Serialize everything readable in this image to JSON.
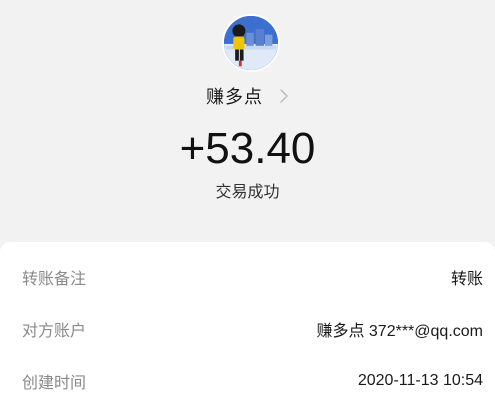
{
  "header": {
    "avatar_icon": "cartoon-avatar-icon",
    "payee_name": "赚多点",
    "chevron_icon": "chevron-right-icon",
    "amount": "+53.40",
    "status": "交易成功"
  },
  "details": [
    {
      "label": "转账备注",
      "value": "转账"
    },
    {
      "label": "对方账户",
      "value": "赚多点 372***@qq.com"
    },
    {
      "label": "创建时间",
      "value": "2020-11-13 10:54"
    }
  ],
  "colors": {
    "page_background": "#f2f2f2",
    "card_background": "#ffffff",
    "label_gray": "#8a8a8a",
    "text_dark": "#1a1a1a"
  }
}
